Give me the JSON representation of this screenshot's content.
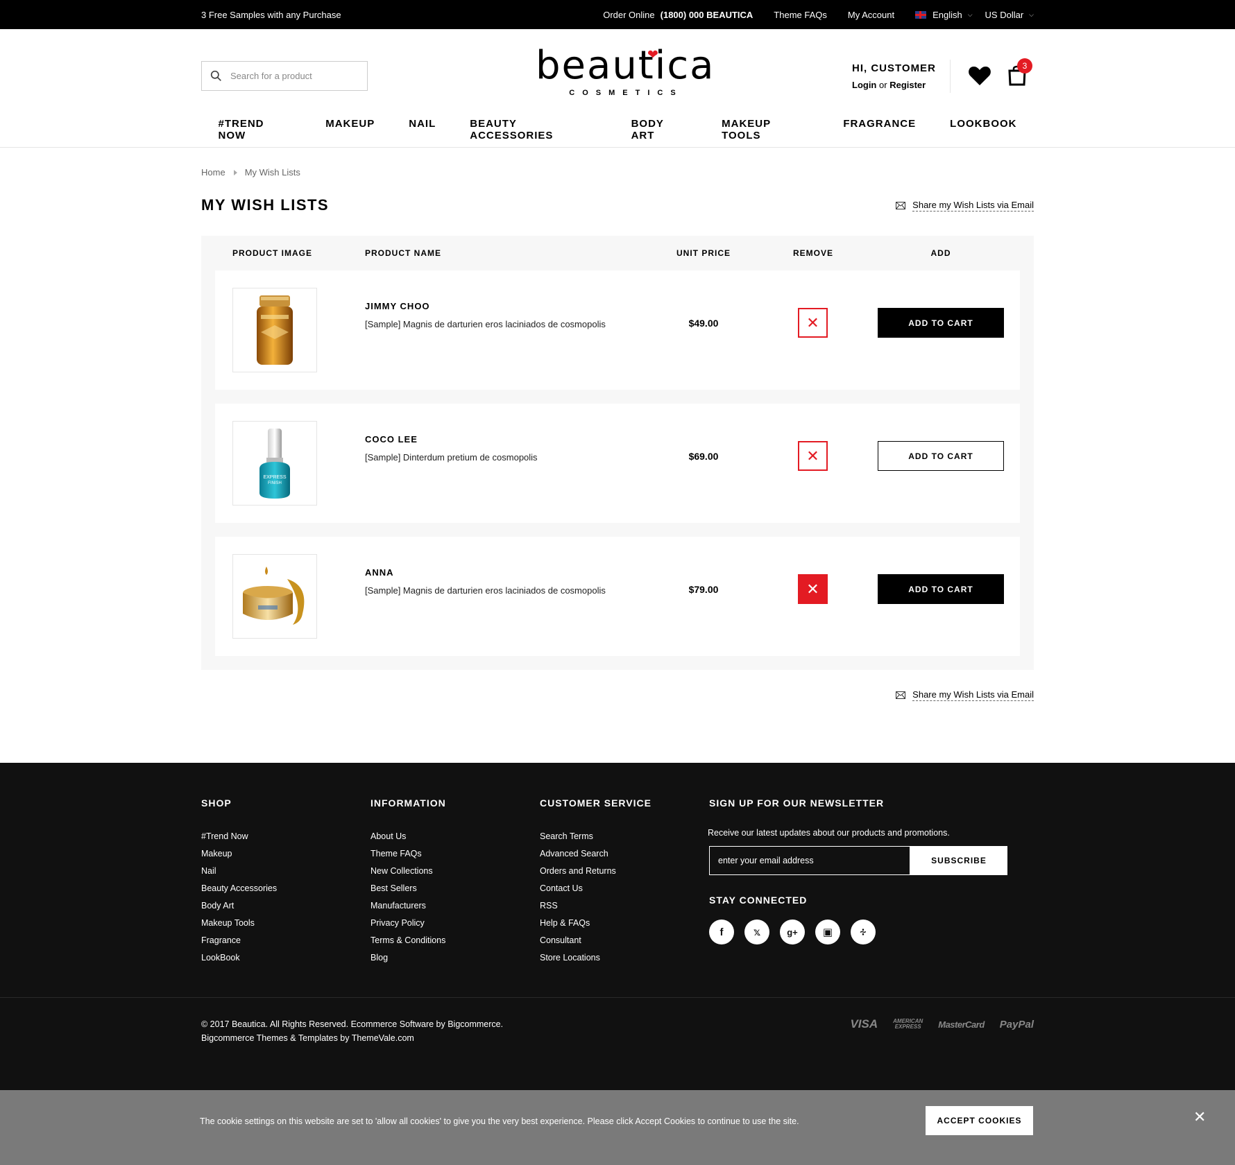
{
  "topbar": {
    "promo": "3 Free Samples with any Purchase",
    "order_label": "Order Online",
    "phone": "(1800) 000 BEAUTICA",
    "faqs": "Theme FAQs",
    "account": "My Account",
    "language": "English",
    "currency": "US Dollar"
  },
  "header": {
    "search_placeholder": "Search for a product",
    "logo_name": "beautica",
    "logo_sub": "COSMETICS",
    "greeting": "HI, CUSTOMER",
    "login": "Login",
    "or": "or",
    "register": "Register",
    "cart_count": "3"
  },
  "nav": [
    "#TREND NOW",
    "MAKEUP",
    "NAIL",
    "BEAUTY ACCESSORIES",
    "BODY ART",
    "MAKEUP TOOLS",
    "FRAGRANCE",
    "LOOKBOOK"
  ],
  "breadcrumb": {
    "home": "Home",
    "current": "My Wish Lists"
  },
  "page": {
    "title": "MY WISH LISTS",
    "share": "Share my Wish Lists via Email"
  },
  "table": {
    "headers": {
      "image": "PRODUCT IMAGE",
      "name": "PRODUCT NAME",
      "price": "UNIT PRICE",
      "remove": "REMOVE",
      "add": "ADD"
    },
    "add_label": "ADD TO CART",
    "rows": [
      {
        "name": "JIMMY CHOO",
        "desc": "[Sample] Magnis de darturien eros laciniados de cosmopolis",
        "price": "$49.00"
      },
      {
        "name": "COCO LEE",
        "desc": "[Sample] Dinterdum pretium de cosmopolis",
        "price": "$69.00"
      },
      {
        "name": "ANNA",
        "desc": "[Sample] Magnis de darturien eros laciniados de cosmopolis",
        "price": "$79.00"
      }
    ]
  },
  "footer": {
    "shop": {
      "title": "SHOP",
      "items": [
        "#Trend Now",
        "Makeup",
        "Nail",
        "Beauty Accessories",
        "Body Art",
        "Makeup Tools",
        "Fragrance",
        "LookBook"
      ]
    },
    "info": {
      "title": "INFORMATION",
      "items": [
        "About Us",
        "Theme FAQs",
        "New Collections",
        "Best Sellers",
        "Manufacturers",
        "Privacy Policy",
        "Terms & Conditions",
        "Blog"
      ]
    },
    "service": {
      "title": "CUSTOMER SERVICE",
      "items": [
        "Search Terms",
        "Advanced Search",
        "Orders and Returns",
        "Contact Us",
        "RSS",
        "Help & FAQs",
        "Consultant",
        "Store Locations"
      ]
    },
    "newsletter": {
      "title": "SIGN UP FOR OUR NEWSLETTER",
      "text": "Receive our latest updates about our products and promotions.",
      "placeholder": "enter your email address",
      "button": "SUBSCRIBE"
    },
    "stay": "STAY CONNECTED",
    "copy1": "© 2017 Beautica. All Rights Reserved. Ecommerce Software by Bigcommerce.",
    "copy2": "Bigcommerce Themes & Templates by ThemeVale.com",
    "payments": {
      "visa": "VISA",
      "amex1": "AMERICAN",
      "amex2": "EXPRESS",
      "mc": "MasterCard",
      "paypal": "PayPal"
    }
  },
  "cookie": {
    "message": "The cookie settings on this website are set to 'allow all cookies' to give you the very best experience. Please click Accept Cookies to continue to use the site.",
    "accept": "ACCEPT COOKIES"
  },
  "colors": {
    "accent_red": "#e31b23",
    "black": "#000000",
    "footer_bg": "#111111",
    "cookie_bg": "#7a7a7a"
  }
}
